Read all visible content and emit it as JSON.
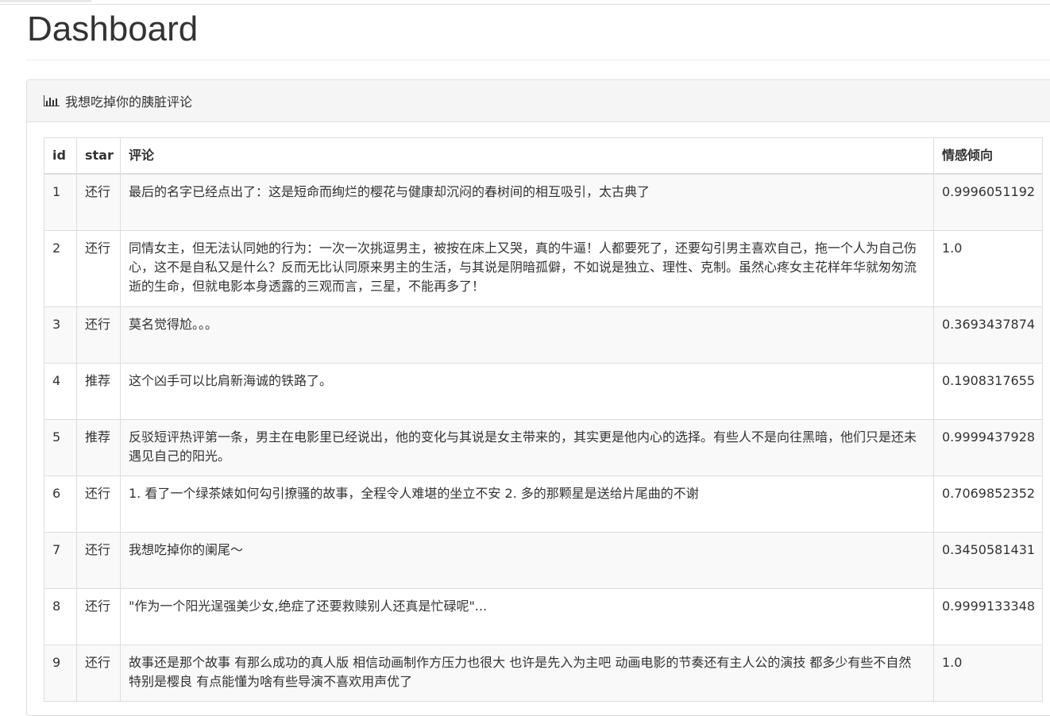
{
  "page": {
    "title": "Dashboard"
  },
  "panel": {
    "icon": "bar-chart-icon",
    "heading": "我想吃掉你的胰脏评论"
  },
  "table": {
    "columns": [
      "id",
      "star",
      "评论",
      "情感倾向"
    ],
    "rows": [
      {
        "id": "1",
        "star": "还行",
        "comment": "最后的名字已经点出了：这是短命而绚烂的樱花与健康却沉闷的春树间的相互吸引，太古典了",
        "sentiment": "0.9996051192"
      },
      {
        "id": "2",
        "star": "还行",
        "comment": "同情女主，但无法认同她的行为：一次一次挑逗男主，被按在床上又哭，真的牛逼！人都要死了，还要勾引男主喜欢自己，拖一个人为自己伤心，这不是自私又是什么？反而无比认同原来男主的生活，与其说是阴暗孤僻，不如说是独立、理性、克制。虽然心疼女主花样年华就匆匆流逝的生命，但就电影本身透露的三观而言，三星，不能再多了！",
        "sentiment": "1.0"
      },
      {
        "id": "3",
        "star": "还行",
        "comment": "莫名觉得尬。。。",
        "sentiment": "0.3693437874"
      },
      {
        "id": "4",
        "star": "推荐",
        "comment": "这个凶手可以比肩新海诚的铁路了。",
        "sentiment": "0.1908317655"
      },
      {
        "id": "5",
        "star": "推荐",
        "comment": "反驳短评热评第一条，男主在电影里已经说出，他的变化与其说是女主带来的，其实更是他内心的选择。有些人不是向往黑暗，他们只是还未遇见自己的阳光。",
        "sentiment": "0.9999437928"
      },
      {
        "id": "6",
        "star": "还行",
        "comment": "1. 看了一个绿茶婊如何勾引撩骚的故事，全程令人难堪的坐立不安 2. 多的那颗星是送给片尾曲的不谢",
        "sentiment": "0.7069852352"
      },
      {
        "id": "7",
        "star": "还行",
        "comment": "我想吃掉你的阑尾～",
        "sentiment": "0.3450581431"
      },
      {
        "id": "8",
        "star": "还行",
        "comment": "\"作为一个阳光逞强美少女,绝症了还要救赎别人还真是忙碌呢\"...",
        "sentiment": "0.9999133348"
      },
      {
        "id": "9",
        "star": "还行",
        "comment": "故事还是那个故事 有那么成功的真人版 相信动画制作方压力也很大 也许是先入为主吧 动画电影的节奏还有主人公的演技 都多少有些不自然 特别是樱良 有点能懂为啥有些导演不喜欢用声优了",
        "sentiment": "1.0"
      }
    ]
  }
}
